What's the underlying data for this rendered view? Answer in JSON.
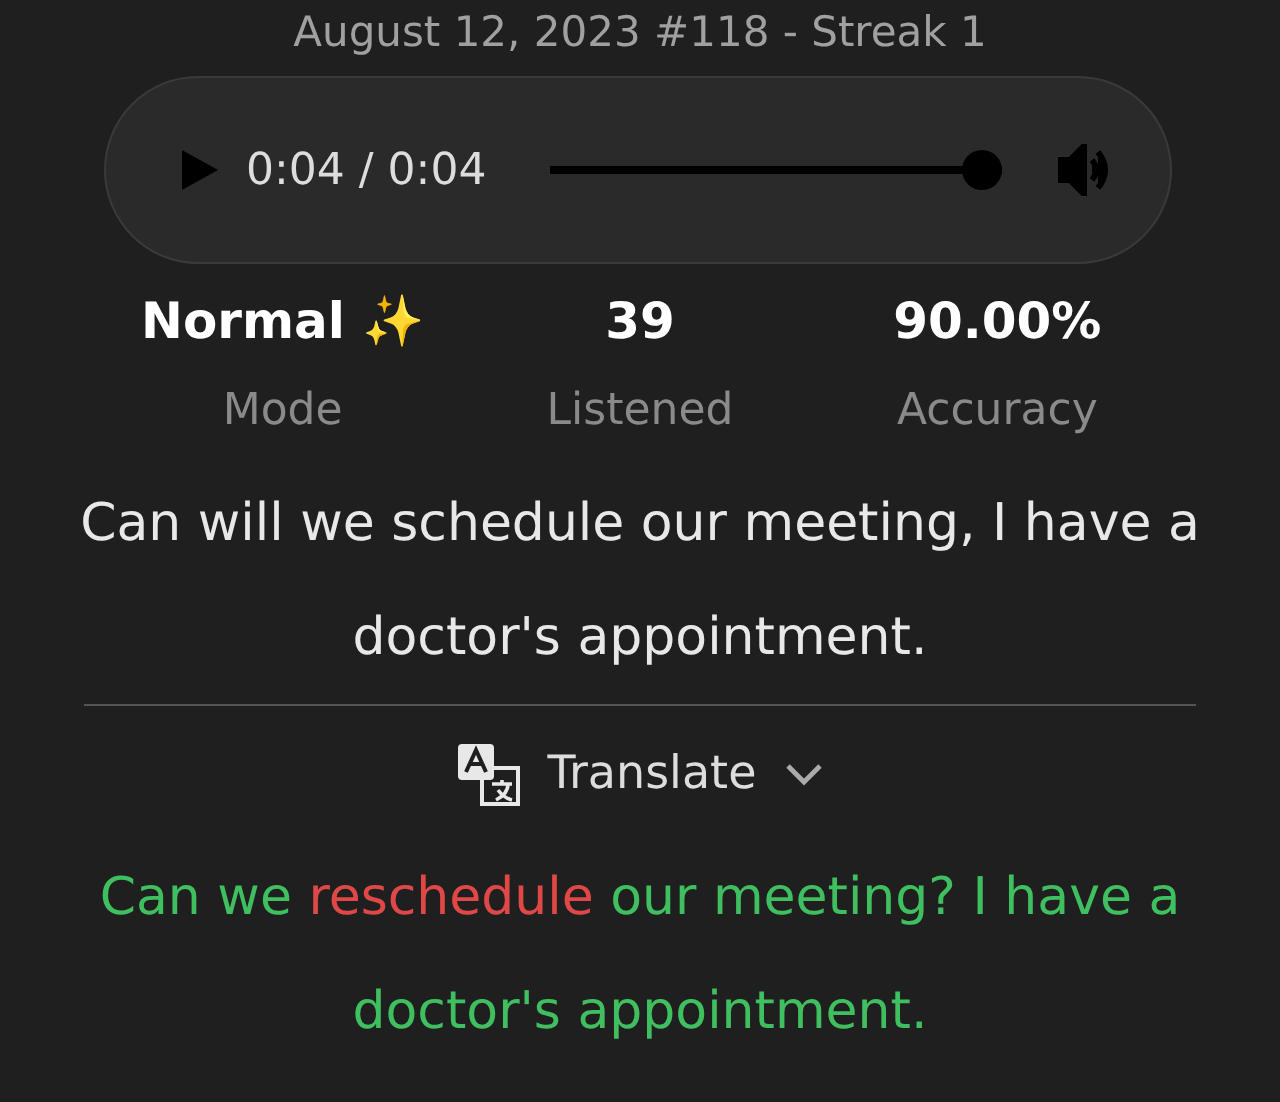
{
  "header": {
    "title": "August 12, 2023 #118 - Streak 1"
  },
  "player": {
    "time": "0:04 / 0:04",
    "level": 1.0
  },
  "stats": [
    {
      "value": "Normal ✨",
      "label": "Mode"
    },
    {
      "value": "39",
      "label": "Listened"
    },
    {
      "value": "90.00%",
      "label": "Accuracy"
    }
  ],
  "sentence": "Can will we schedule our meeting, I have a doctor's appointment.",
  "translate": {
    "label": "Translate",
    "expanded": false
  },
  "correction": [
    {
      "kind": "match",
      "text": "Can we "
    },
    {
      "kind": "error",
      "text": "reschedule"
    },
    {
      "kind": "match",
      "text": " our meeting? I have a doctor's appointment."
    }
  ]
}
